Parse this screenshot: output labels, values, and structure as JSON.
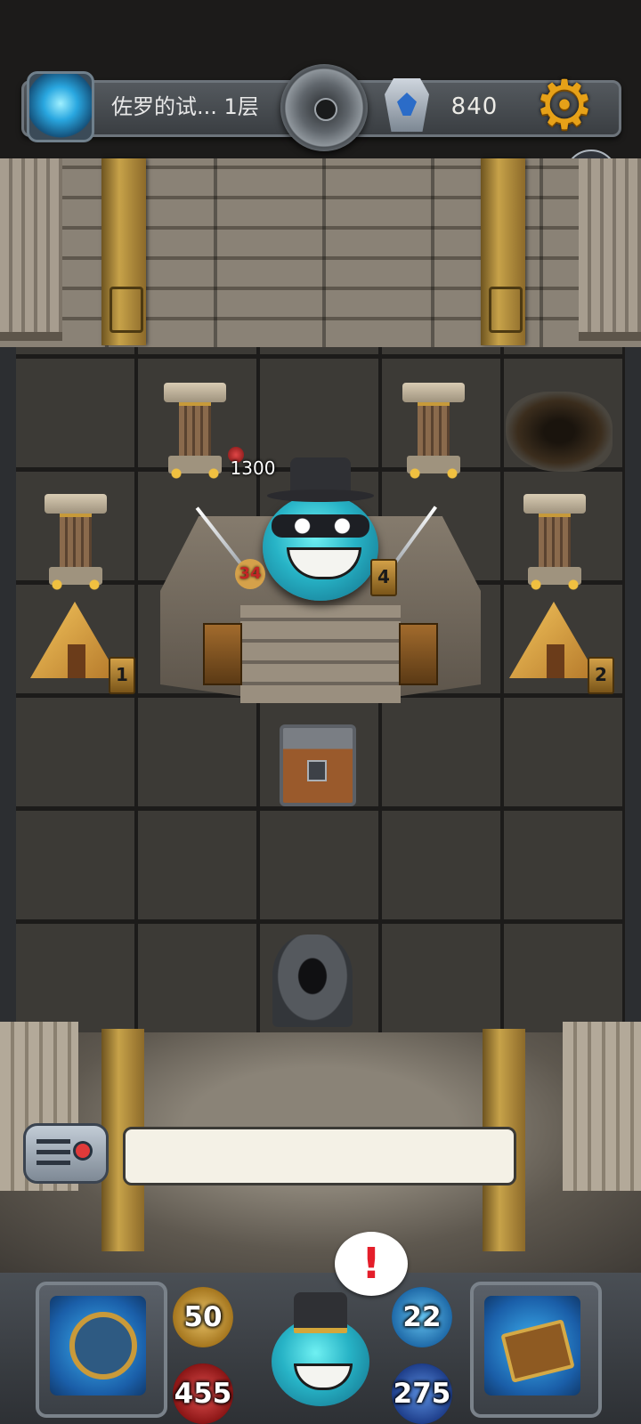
{
  "top_bar": {
    "level_title": "佐罗的试... 1层",
    "gem_count": "840"
  },
  "board": {
    "boss": {
      "hp": "1300",
      "attack": "34",
      "timer": "4"
    },
    "left_tent_timer": "1",
    "right_tent_timer": "2"
  },
  "player_stats": {
    "attack": "50",
    "hp": "455",
    "defense": "22",
    "mana": "275"
  },
  "alert": "!",
  "colors": {
    "gold_accent": "#e6a118",
    "hp_red": "#c42525",
    "alert_red": "#e41e2a"
  }
}
